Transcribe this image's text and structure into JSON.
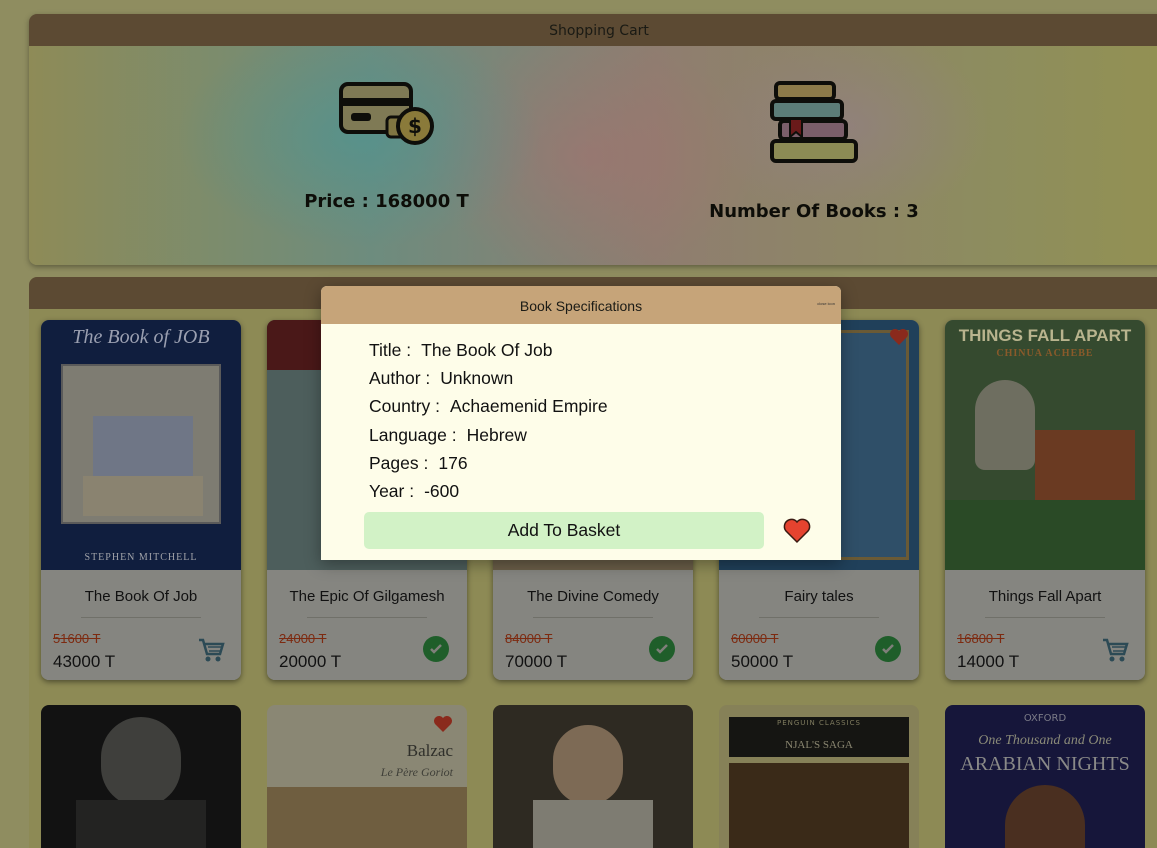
{
  "cart": {
    "title": "Shopping Cart",
    "price_label": "Price : 168000 T",
    "books_label": "Number Of Books : 3"
  },
  "books": [
    {
      "title": "The Book Of Job",
      "old_price": "51600 T",
      "price": "43000 T",
      "action": "cart-icon",
      "cover_top": "The Book of JOB",
      "cover_bottom": "STEPHEN MITCHELL"
    },
    {
      "title": "The Epic Of Gilgamesh",
      "old_price": "24000 T",
      "price": "20000 T",
      "action": "check-icon"
    },
    {
      "title": "The Divine Comedy",
      "old_price": "84000 T",
      "price": "70000 T",
      "action": "check-icon"
    },
    {
      "title": "Fairy tales",
      "old_price": "60000 T",
      "price": "50000 T",
      "action": "check-icon"
    },
    {
      "title": "Things Fall Apart",
      "old_price": "16800 T",
      "price": "14000 T",
      "action": "cart-icon",
      "cover_top": "THINGS FALL APART",
      "cover_sub": "CHINUA ACHEBE"
    }
  ],
  "row2": [
    {
      "cover_top": ""
    },
    {
      "cover_top": "Balzac",
      "cover_sub": "Le Père Goriot"
    },
    {
      "cover_top": ""
    },
    {
      "cover_top": "NJAL'S SAGA",
      "cover_sub": "PENGUIN CLASSICS"
    },
    {
      "cover_top": "One Thousand and One",
      "cover_sub": "ARABIAN NIGHTS",
      "cover_pub": "OXFORD"
    }
  ],
  "modal": {
    "title": "Book Specifications",
    "close_label": "close icon",
    "specs": [
      {
        "key": "Title :",
        "value": "The Book Of Job"
      },
      {
        "key": "Author :",
        "value": "Unknown"
      },
      {
        "key": "Country :",
        "value": "Achaemenid Empire"
      },
      {
        "key": "Language :",
        "value": "Hebrew"
      },
      {
        "key": "Pages :",
        "value": "176"
      },
      {
        "key": "Year :",
        "value": "-600"
      }
    ],
    "add_label": "Add To Basket",
    "favorite_icon": "heart-icon"
  },
  "colors": {
    "modal_header": "#c6a479",
    "modal_bg": "#fefde9",
    "add_button": "#d2f2c6",
    "heart": "#e5432f"
  }
}
